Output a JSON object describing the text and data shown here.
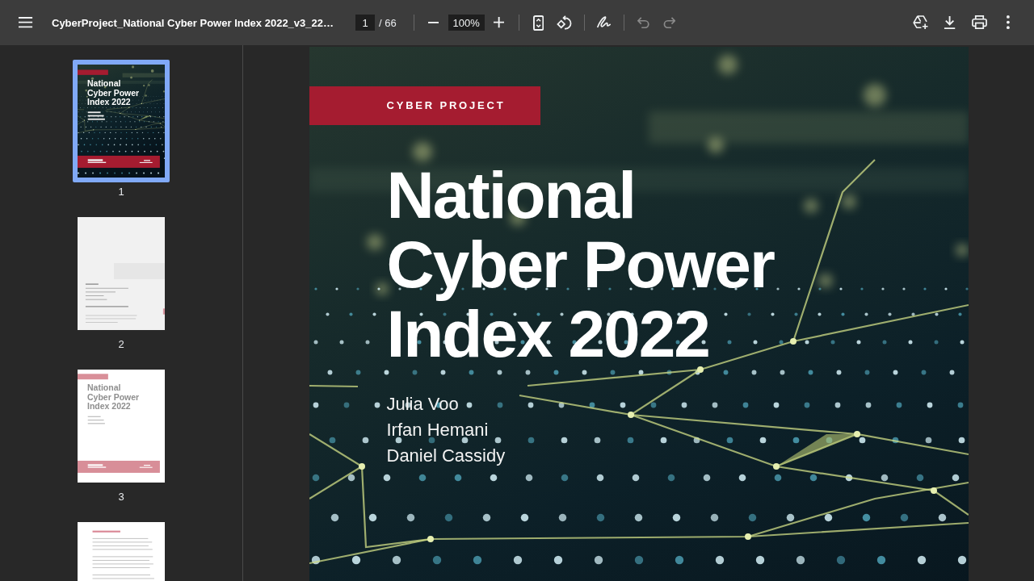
{
  "toolbar": {
    "title": "CyberProject_National Cyber Power Index 2022_v3_22…",
    "page": {
      "current": "1",
      "total": "/ 66"
    },
    "zoom": {
      "value": "100%"
    },
    "tool_groups": [
      {
        "tools": [
          {
            "kind": "fit-page",
            "disabled": false
          },
          {
            "kind": "rotate",
            "disabled": false
          }
        ]
      },
      {
        "tools": [
          {
            "kind": "annotate",
            "disabled": false
          }
        ]
      },
      {
        "tools": [
          {
            "kind": "undo",
            "disabled": true
          },
          {
            "kind": "redo",
            "disabled": true
          }
        ]
      }
    ],
    "actions": [
      {
        "kind": "add-to-drive"
      },
      {
        "kind": "download"
      },
      {
        "kind": "print"
      },
      {
        "kind": "more"
      }
    ]
  },
  "sidebar": {
    "thumbnails": [
      {
        "kind": "cover",
        "label": "1",
        "selected": true,
        "title": "National Cyber Power Index 2022"
      },
      {
        "kind": "credits",
        "label": "2",
        "selected": false
      },
      {
        "kind": "cover-light",
        "label": "3",
        "selected": false,
        "title": "National Cyber Power Index 2022"
      },
      {
        "kind": "text",
        "selected": false
      }
    ]
  },
  "document": {
    "page": {
      "tag": "CYBER PROJECT",
      "title": "National Cyber Power Index 2022",
      "authors": [
        "Julia Voo",
        "Irfan Hemani",
        "Daniel Cassidy"
      ]
    }
  }
}
